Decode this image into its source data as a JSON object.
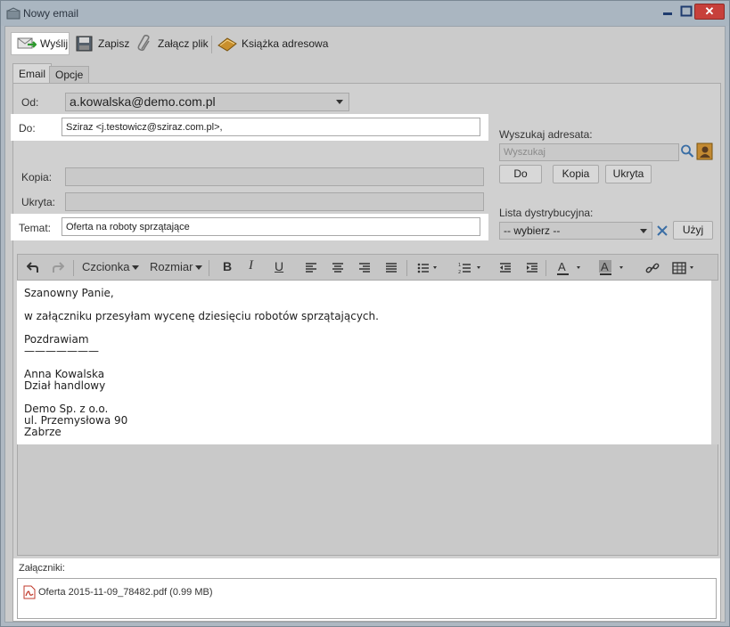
{
  "window": {
    "title": "Nowy email",
    "close_glyph": "✕"
  },
  "toolbar": {
    "send_label": "Wyślij",
    "save_label": "Zapisz",
    "attach_label": "Załącz plik",
    "addressbook_label": "Książka adresowa"
  },
  "tabs": [
    {
      "label": "Email",
      "active": true
    },
    {
      "label": "Opcje",
      "active": false
    }
  ],
  "form": {
    "from_label": "Od:",
    "from_value": "a.kowalska@demo.com.pl",
    "to_label": "Do:",
    "to_value": "Sziraz <j.testowicz@sziraz.com.pl>,",
    "cc_label": "Kopia:",
    "cc_value": "",
    "bcc_label": "Ukryta:",
    "bcc_value": "",
    "subject_label": "Temat:",
    "subject_value": "Oferta na roboty sprzątające"
  },
  "recipient_search": {
    "label": "Wyszukaj adresata:",
    "placeholder": "Wyszukaj",
    "to_button": "Do",
    "cc_button": "Kopia",
    "bcc_button": "Ukryta"
  },
  "distribution": {
    "label": "Lista dystrybucyjna:",
    "selected": "-- wybierz --",
    "use_button": "Użyj"
  },
  "editor_toolbar": {
    "font_label": "Czcionka",
    "size_label": "Rozmiar",
    "bold": "B",
    "italic": "I",
    "underline": "U"
  },
  "body": {
    "lines": [
      "Szanowny Panie,",
      "",
      "w załączniku przesyłam wycenę dziesięciu robotów sprzątających.",
      "",
      "Pozdrawiam",
      "———————",
      "",
      "Anna Kowalska",
      "Dział handlowy",
      "",
      "Demo Sp. z o.o.",
      "ul. Przemysłowa 90",
      "Zabrze"
    ]
  },
  "attachments": {
    "label": "Załączniki:",
    "items": [
      {
        "name": "Oferta 2015-11-09_78482.pdf (0.99 MB)",
        "icon": "pdf-icon"
      }
    ]
  },
  "colors": {
    "close_button": "#c7403b",
    "panel": "#cbcbcb",
    "highlight": "#ffffff"
  }
}
